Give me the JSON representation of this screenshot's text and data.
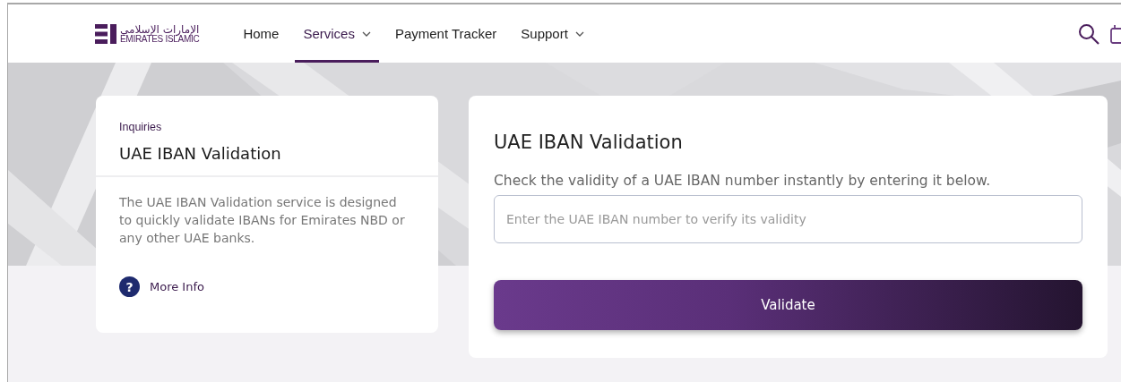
{
  "header": {
    "logo": {
      "arabic": "الإمارات الإسلامي",
      "english": "EMIRATES ISLAMIC"
    },
    "nav": [
      {
        "label": "Home",
        "selected": false,
        "dropdown": false
      },
      {
        "label": "Services",
        "selected": true,
        "dropdown": true
      },
      {
        "label": "Payment Tracker",
        "selected": false,
        "dropdown": false
      },
      {
        "label": "Support",
        "selected": false,
        "dropdown": true
      }
    ]
  },
  "info_card": {
    "breadcrumb": "Inquiries",
    "title": "UAE IBAN Validation",
    "description": "The UAE IBAN Validation service is designed to quickly validate IBANs for Emirates NBD or any other UAE banks.",
    "more_info": {
      "icon": "?",
      "label": "More Info"
    }
  },
  "form_card": {
    "title": "UAE IBAN Validation",
    "subtitle": "Check the validity of a UAE IBAN number instantly by entering it below.",
    "placeholder": "Enter the UAE IBAN number to verify its validity",
    "button": "Validate"
  }
}
